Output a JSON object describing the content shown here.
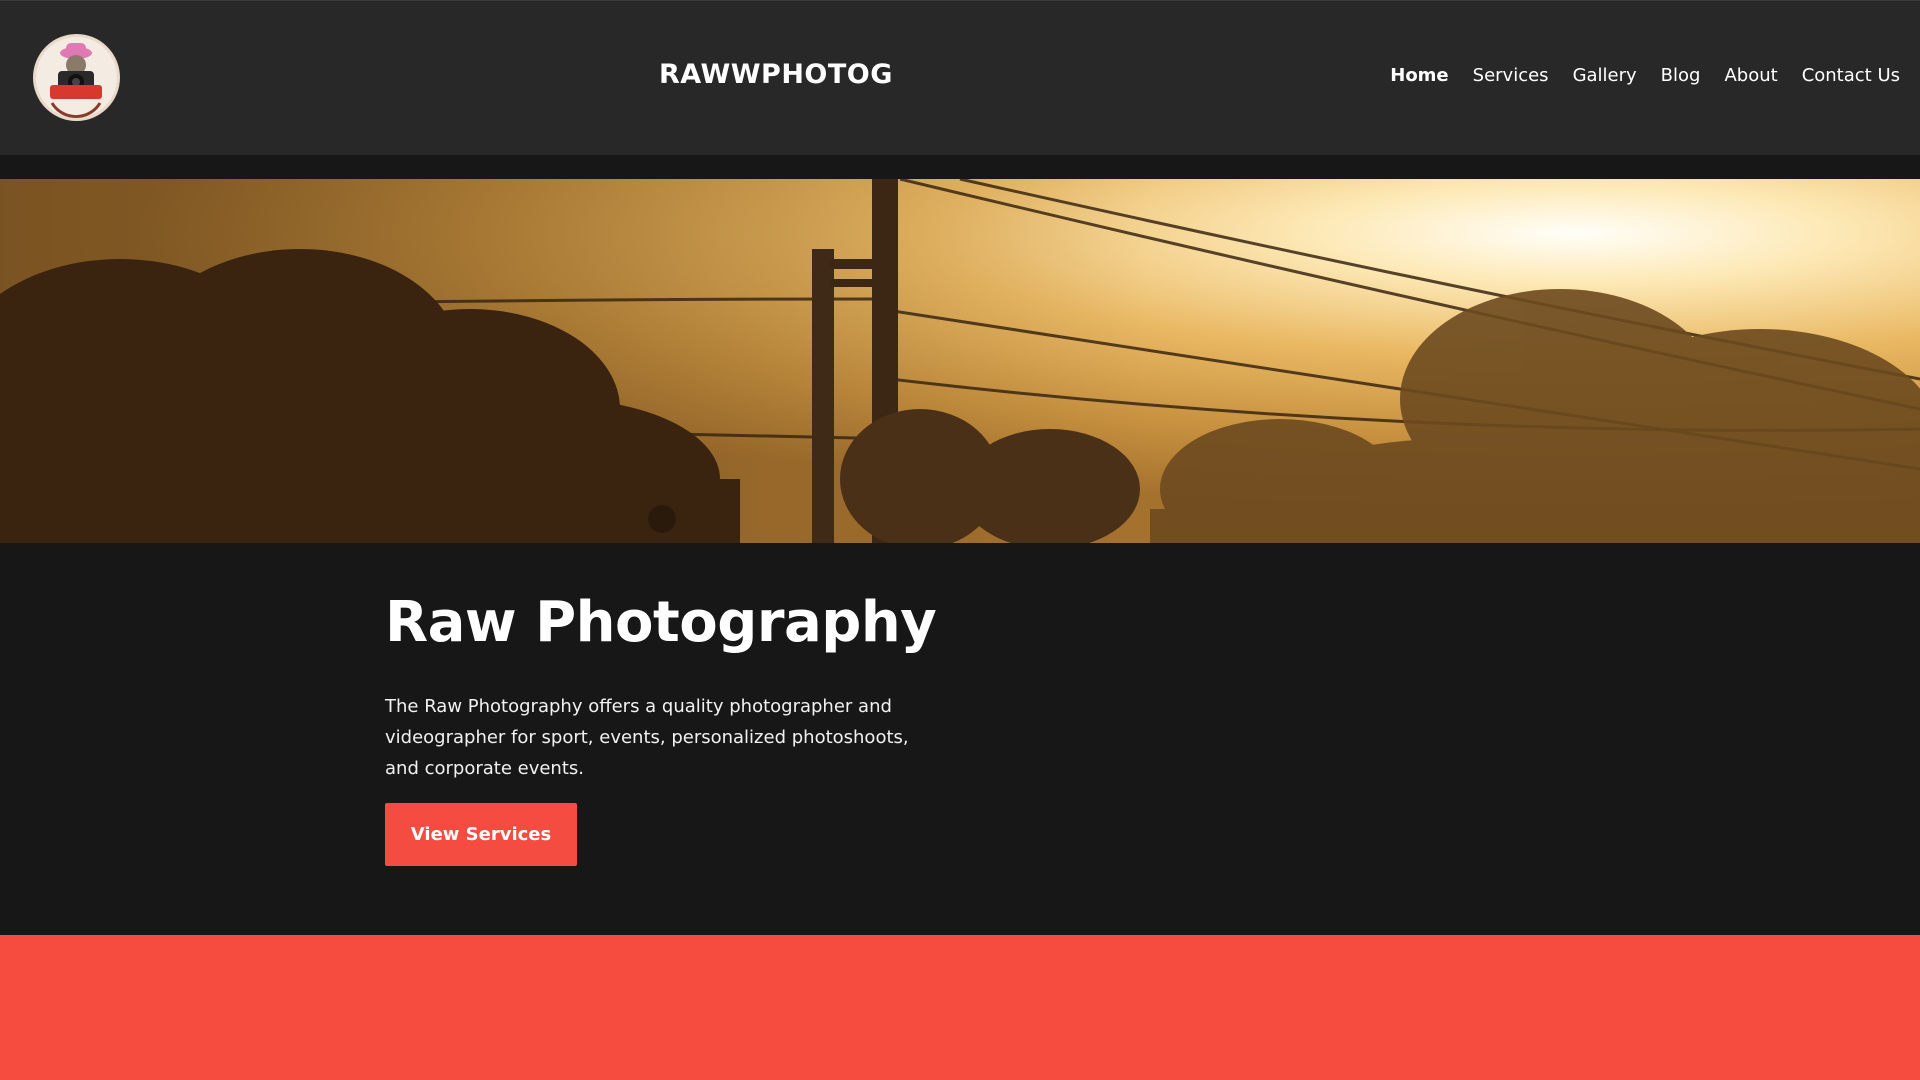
{
  "site": {
    "title": "RAWWPHOTOG",
    "logo_icon": "raw-photography-logo"
  },
  "nav": {
    "items": [
      {
        "label": "Home",
        "active": true
      },
      {
        "label": "Services",
        "active": false
      },
      {
        "label": "Gallery",
        "active": false
      },
      {
        "label": "Blog",
        "active": false
      },
      {
        "label": "About",
        "active": false
      },
      {
        "label": "Contact Us",
        "active": false
      }
    ]
  },
  "hero": {
    "heading": "Raw Photography",
    "description": "The Raw Photography offers a quality photographer and videographer for sport, events, personalized photoshoots, and corporate events.",
    "button_label": "View Services"
  },
  "colors": {
    "header_bg": "#282828",
    "page_bg": "#171717",
    "accent": "#f54c41"
  }
}
